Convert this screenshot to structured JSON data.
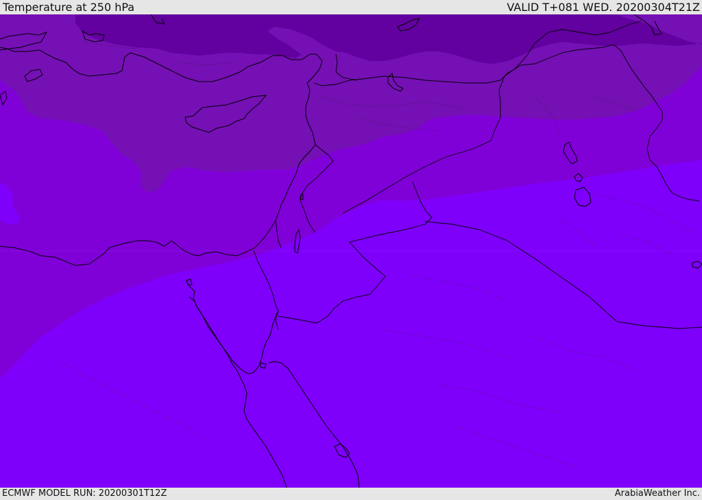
{
  "header": {
    "title": "Temperature at 250 hPa",
    "valid": "VALID T+081 WED. 20200304T21Z"
  },
  "footer": {
    "model_run": "ECMWF MODEL RUN: 20200301T12Z",
    "credit": "ArabiaWeather Inc."
  },
  "map": {
    "field": "Temperature at 250 hPa",
    "colors": {
      "band_darkest": "#6200a0",
      "band_dark": "#7410b4",
      "band_mid": "#8000d8",
      "band_light": "#7e00fa"
    }
  }
}
